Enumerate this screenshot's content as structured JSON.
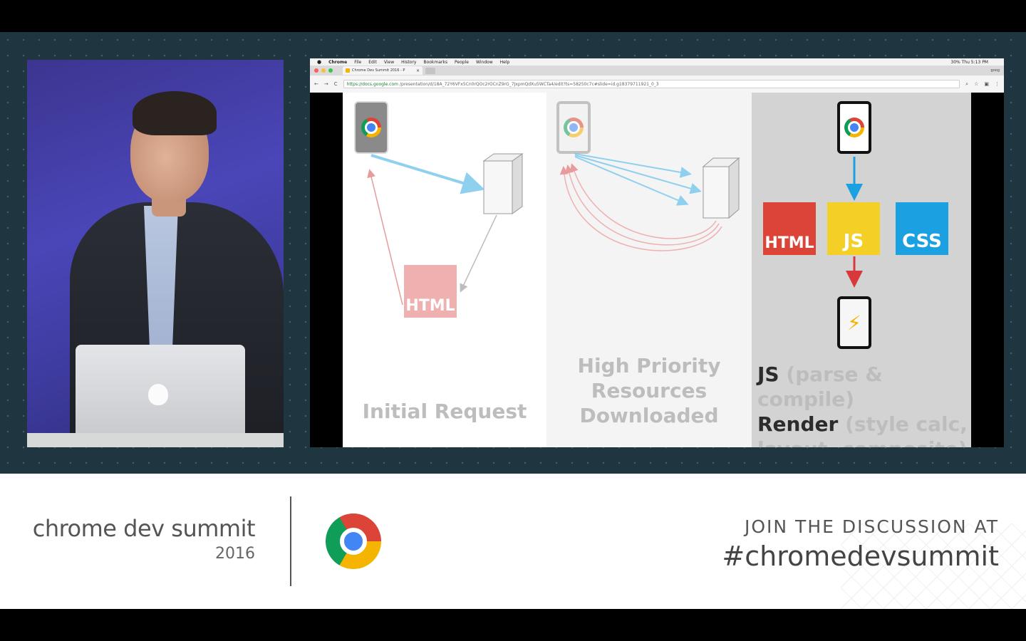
{
  "menubar": {
    "apple": "",
    "app": "Chrome",
    "items": [
      "File",
      "Edit",
      "View",
      "History",
      "Bookmarks",
      "People",
      "Window",
      "Help"
    ],
    "status": "30%  Thu 5:13 PM"
  },
  "browser": {
    "tab_title": "Chrome Dev Summit 2016 - P",
    "tab_close": "×",
    "user": "goog",
    "nav": {
      "back": "←",
      "forward": "→",
      "reload": "C"
    },
    "url_host": "https://docs.google.com",
    "url_path": "/presentation/d/18A_72Y6VFx5Cn0rQOc2rOCnZ9rG_7JxpmQdXu5WCTa4/edit?ts=58250c7c#slide=id.g18379711921_0_3"
  },
  "slide": {
    "panel1_caption": "Initial Request",
    "panel2_caption": "High Priority Resources Downloaded",
    "panel3_caption_js": "JS",
    "panel3_caption_js_detail": " (parse & compile)",
    "panel3_caption_render": "Render",
    "panel3_caption_render_detail": " (style calc, layout, composite)",
    "html_label_faded": "HTML",
    "html_label": "HTML",
    "js_label": "JS",
    "css_label": "CSS",
    "bolt": "⚡"
  },
  "lower_third": {
    "brand": "chrome dev summit",
    "year": "2016",
    "join": "JOIN THE DISCUSSION AT",
    "hashtag": "#chromedevsummit"
  },
  "colors": {
    "stage_bg": "#1f3640",
    "chrome_red": "#db4437",
    "chrome_yellow": "#f4b400",
    "chrome_green": "#0f9d58",
    "chrome_blue": "#4285f4",
    "css_blue": "#1ba1e2",
    "arrow_blue": "#8fd0ef",
    "arrow_red": "#e89b9b"
  }
}
